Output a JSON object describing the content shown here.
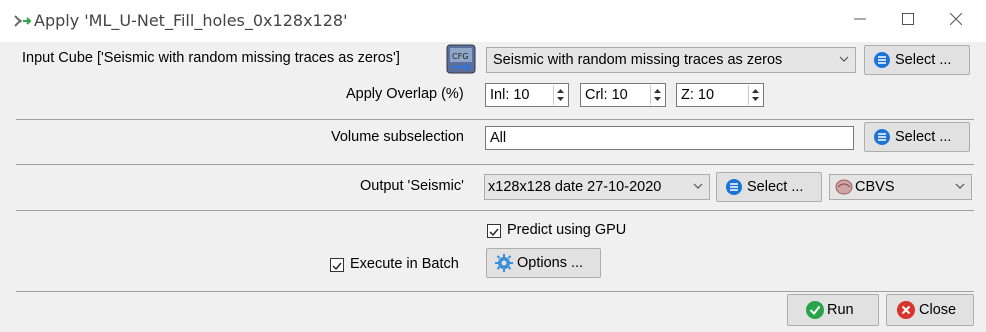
{
  "window": {
    "title": "Apply 'ML_U-Net_Fill_holes_0x128x128'",
    "app_icon": "network-arrow-icon",
    "controls": [
      "minimize-icon",
      "maximize-icon",
      "close-icon"
    ]
  },
  "input": {
    "label": "Input Cube ['Seismic with random missing traces as zeros']",
    "combo_value": "Seismic with random missing traces as zeros",
    "select_label": "Select ..."
  },
  "overlap": {
    "label": "Apply Overlap (%)",
    "inl": "Inl: 10",
    "crl": "Crl: 10",
    "z": "Z: 10"
  },
  "volume": {
    "label": "Volume subselection",
    "value": "All",
    "select_label": "Select ..."
  },
  "output": {
    "label": "Output 'Seismic'",
    "combo_value": "x128x128 date  27-10-2020",
    "select_label": "Select ...",
    "format_value": "CBVS"
  },
  "options": {
    "predict_gpu_label": "Predict using GPU",
    "predict_gpu_checked": true,
    "batch_label": "Execute in Batch",
    "batch_checked": true,
    "options_button": "Options ..."
  },
  "footer": {
    "run_label": "Run",
    "close_label": "Close"
  },
  "colors": {
    "accent_blue": "#1e73d6",
    "run_green": "#2aa34a",
    "close_red": "#d9342b"
  }
}
